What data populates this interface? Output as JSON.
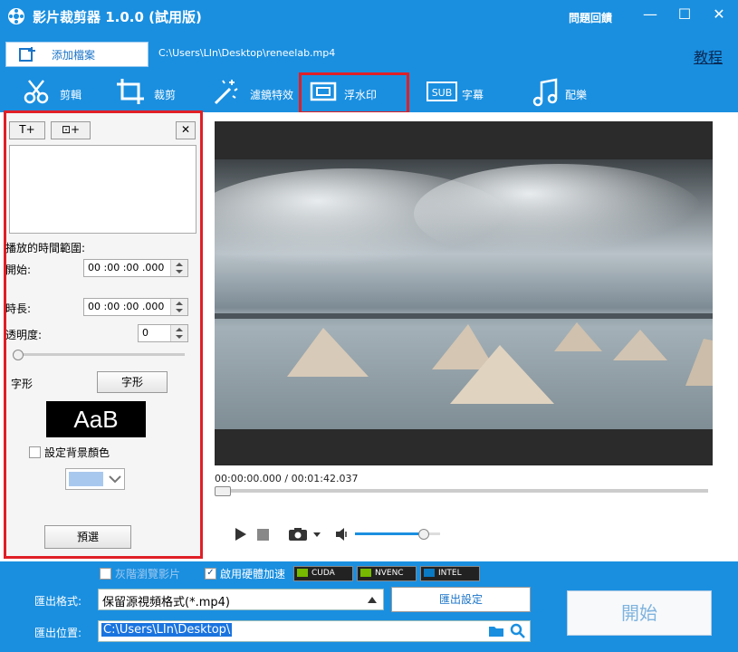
{
  "window": {
    "title": "影片裁剪器 1.0.0 (試用版)",
    "feedback": "問題回饋",
    "minimize": "—",
    "maximize": "☐",
    "close": "✕"
  },
  "toolbar": {
    "add_file": "添加檔案",
    "file_path": "C:\\Users\\LIn\\Desktop\\reneelab.mp4",
    "tutorial": "教程"
  },
  "tabs": [
    {
      "label": "剪輯",
      "icon": "scissors-icon"
    },
    {
      "label": "裁剪",
      "icon": "crop-icon"
    },
    {
      "label": "濾鏡特效",
      "icon": "magic-wand-icon"
    },
    {
      "label": "浮水印",
      "icon": "watermark-icon",
      "active": true
    },
    {
      "label": "字幕",
      "icon": "subtitle-icon"
    },
    {
      "label": "配樂",
      "icon": "music-icon"
    }
  ],
  "watermark_panel": {
    "add_text": "T+",
    "add_image": "⊡+",
    "remove": "✕",
    "time_range_label": "播放的時間範圍:",
    "start_label": "開始:",
    "start_value": "00 :00 :00 .000",
    "duration_label": "時長:",
    "duration_value": "00 :00 :00 .000",
    "opacity_label": "透明度:",
    "opacity_value": "0",
    "opacity_level": 0,
    "font_label": "字形",
    "font_button": "字形",
    "font_preview": "AaB",
    "bg_color_label": "設定背景顏色",
    "bg_color_checked": false,
    "bg_color_swatch": "#a9c8ee",
    "preset_button": "預選"
  },
  "player": {
    "time_current": "00:00:00.000",
    "time_total": "/ 00:01:42.037",
    "progress": 0,
    "volume": 0.8
  },
  "output": {
    "grayscale_label": "灰階瀏覽影片",
    "grayscale_checked": false,
    "hw_accel_label": "啟用硬體加速",
    "hw_accel_checked": true,
    "gpu_badges": [
      "CUDA",
      "NVENC",
      "INTEL"
    ],
    "format_label": "匯出格式:",
    "format_value": "保留源視頻格式(*.mp4)",
    "settings_button": "匯出設定",
    "location_label": "匯出位置:",
    "location_value": "C:\\Users\\LIn\\Desktop\\",
    "start_button": "開始"
  }
}
